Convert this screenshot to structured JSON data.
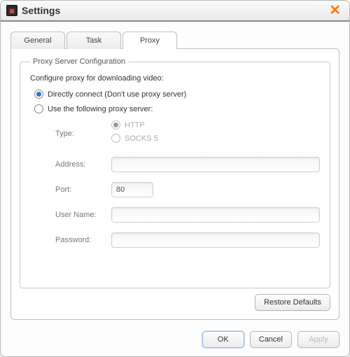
{
  "window": {
    "title": "Settings"
  },
  "tabs": {
    "general": "General",
    "task": "Task",
    "proxy": "Proxy",
    "active": "proxy"
  },
  "group": {
    "legend": "Proxy Server Configuration",
    "desc": "Configure proxy for downloading video:"
  },
  "mode": {
    "direct": "Directly connect (Don't use proxy server)",
    "useproxy": "Use the following proxy server:",
    "selected": "direct"
  },
  "type": {
    "label": "Type:",
    "http": "HTTP",
    "socks5": "SOCKS 5",
    "selected": "http"
  },
  "fields": {
    "address_label": "Address:",
    "address_value": "",
    "port_label": "Port:",
    "port_value": "80",
    "username_label": "User Name:",
    "username_value": "",
    "password_label": "Password:",
    "password_value": ""
  },
  "buttons": {
    "restore": "Restore Defaults",
    "ok": "OK",
    "cancel": "Cancel",
    "apply": "Apply"
  }
}
